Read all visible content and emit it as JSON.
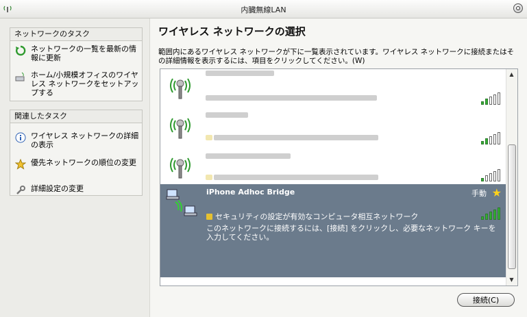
{
  "window": {
    "title": "内臓無線LAN"
  },
  "sidebar": {
    "network_tasks": {
      "header": "ネットワークのタスク",
      "items": [
        {
          "label": "ネットワークの一覧を最新の情報に更新",
          "icon": "refresh-icon"
        },
        {
          "label": "ホーム/小規模オフィスのワイヤレス ネットワークをセットアップする",
          "icon": "wireless-setup-icon"
        }
      ]
    },
    "related_tasks": {
      "header": "関連したタスク",
      "items": [
        {
          "label": "ワイヤレス ネットワークの詳細の表示",
          "icon": "info-icon"
        },
        {
          "label": "優先ネットワークの順位の変更",
          "icon": "star-icon"
        },
        {
          "label": "詳細設定の変更",
          "icon": "wrench-icon"
        }
      ]
    }
  },
  "main": {
    "title": "ワイヤレス ネットワークの選択",
    "description": "範囲内にあるワイヤレス ネットワークが下に一覧表示されています。ワイヤレス ネットワークに接続またはその詳細情報を表示するには、項目をクリックしてください。(W)",
    "selected_network": {
      "name": "iPhone Adhoc Bridge",
      "mode": "手動",
      "security": "セキュリティの設定が有効なコンピュータ相互ネットワーク",
      "message": "このネットワークに接続するには、[接続] をクリックし、必要なネットワーク キーを入力してください。",
      "signal_bars": 5
    },
    "other_networks_signal_bars": [
      2,
      2,
      1
    ],
    "connect_button": "接続(C)"
  }
}
